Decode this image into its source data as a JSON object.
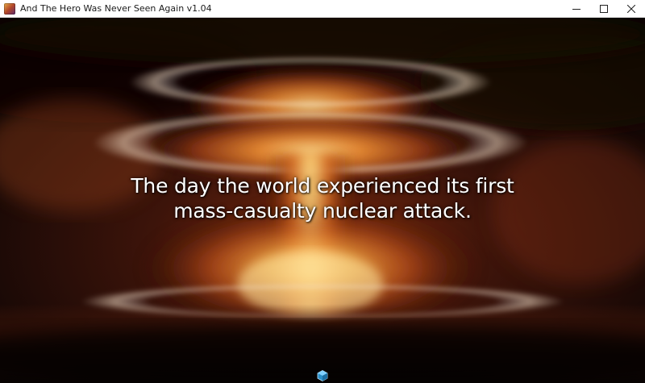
{
  "window": {
    "title": "And The Hero Was Never Seen Again v1.04",
    "icon": "game-app-icon",
    "controls": [
      "minimize-icon",
      "maximize-icon",
      "close-icon"
    ]
  },
  "scene": {
    "background": "nuclear-mushroom-cloud",
    "narration": {
      "line1": "The day the world experienced its first",
      "line2": "mass-casualty nuclear attack."
    },
    "continue_indicator": "continue-cursor-icon"
  },
  "colors": {
    "titlebar_bg": "#ffffff",
    "title_text": "#1a1a1a",
    "narration_text": "#ffffff",
    "fire_core": "#ffd27a",
    "fire_mid": "#e0641c",
    "smoke_dark": "#1a0c07"
  }
}
